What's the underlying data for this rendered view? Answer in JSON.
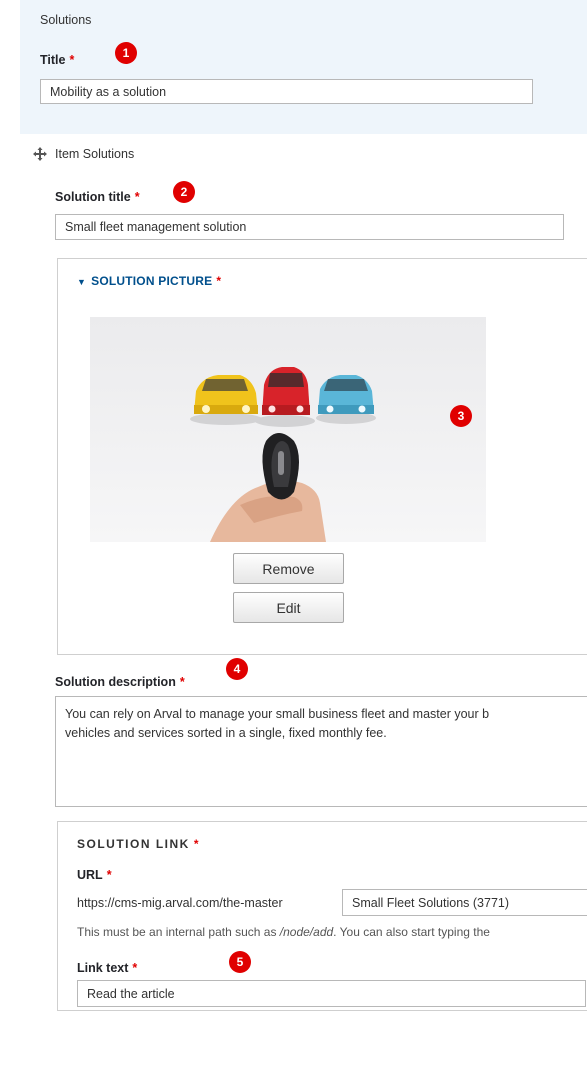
{
  "solutions": {
    "heading": "Solutions",
    "title_label": "Title",
    "title_value": "Mobility as a solution"
  },
  "item": {
    "label": "Item Solutions",
    "solution_title_label": "Solution title",
    "solution_title_value": "Small fleet management solution",
    "picture_summary": "SOLUTION PICTURE",
    "remove_label": "Remove",
    "edit_label": "Edit",
    "description_label": "Solution description",
    "description_line1": "You can rely on Arval to manage your small business fleet and master your b",
    "description_line2": "vehicles and services sorted in a single, fixed monthly fee.",
    "link_title": "SOLUTION LINK",
    "url_label": "URL",
    "url_prefix": "https://cms-mig.arval.com/the-master",
    "url_value": "Small Fleet Solutions (3771)",
    "url_help_before": "This must be an internal path such as ",
    "url_help_path": "/node/add",
    "url_help_after": ". You can also start typing the",
    "link_text_label": "Link text",
    "link_text_value": "Read the article"
  },
  "required_mark": "*",
  "markers": [
    "1",
    "2",
    "3",
    "4",
    "5"
  ],
  "icons": {
    "drag": "move-cross-icon",
    "summary": "triangle-down-icon"
  },
  "colors": {
    "required": "#e00000",
    "marker": "#e00000",
    "summary_link": "#004f8c",
    "panel_bg": "#eef5fb"
  }
}
